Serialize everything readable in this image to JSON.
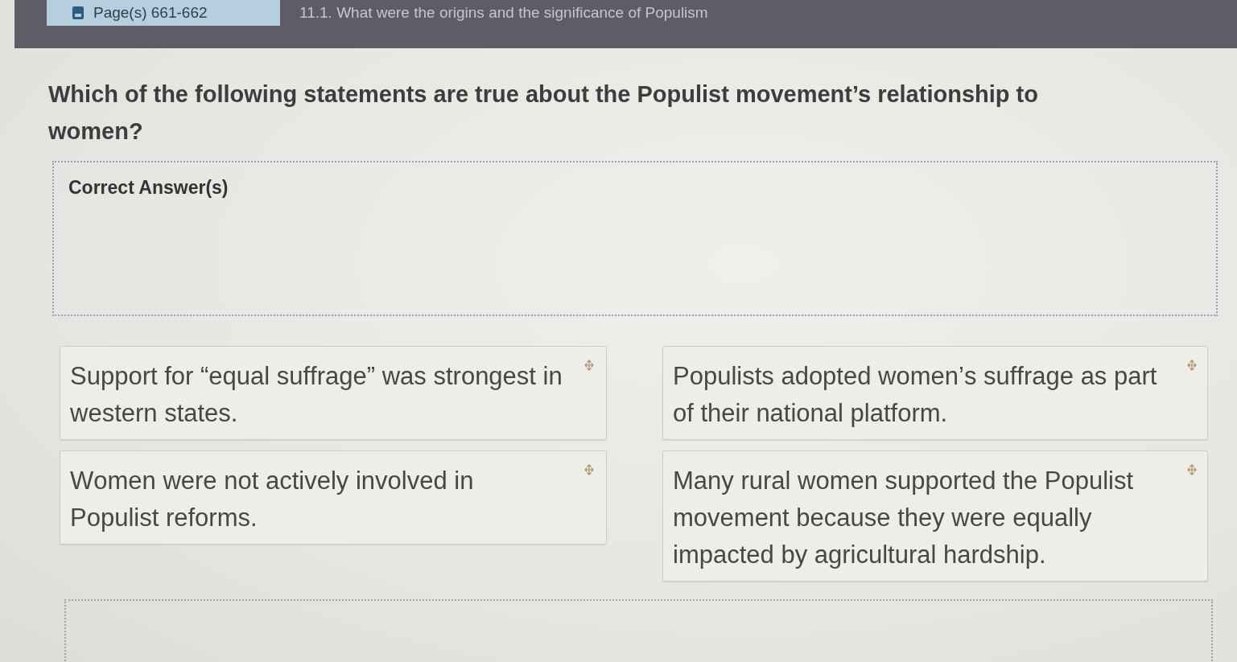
{
  "header": {
    "page_tab": "Page(s) 661-662",
    "section_title": "11.1. What were the origins and the significance of Populism"
  },
  "question": "Which of the following statements are true about the Populist movement’s relationship to women?",
  "answer_zone": {
    "label": "Correct Answer(s)"
  },
  "choices": [
    {
      "text": "Support for “equal suffrage” was strongest in western states."
    },
    {
      "text": "Populists adopted women’s suffrage as part of their national platform."
    },
    {
      "text": "Women were not actively involved in Populist reforms."
    },
    {
      "text": "Many rural women supported the Populist movement because they were equally impacted by agricultural hardship."
    }
  ]
}
